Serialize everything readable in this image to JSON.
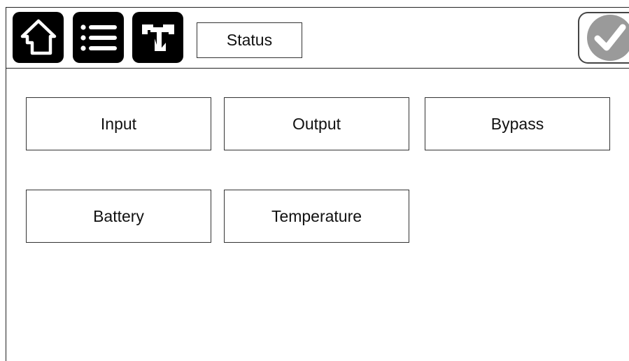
{
  "header": {
    "home_icon": "home-icon",
    "menu_icon": "list-menu-icon",
    "tools_icon": "tools-icon",
    "title": "Status",
    "confirm_icon": "checkmark-icon"
  },
  "tiles": [
    {
      "label": "Input"
    },
    {
      "label": "Output"
    },
    {
      "label": "Bypass"
    },
    {
      "label": "Battery"
    },
    {
      "label": "Temperature"
    }
  ],
  "colors": {
    "icon_background": "#000000",
    "confirm_disabled": "#9a9a9a",
    "border": "#333333"
  }
}
